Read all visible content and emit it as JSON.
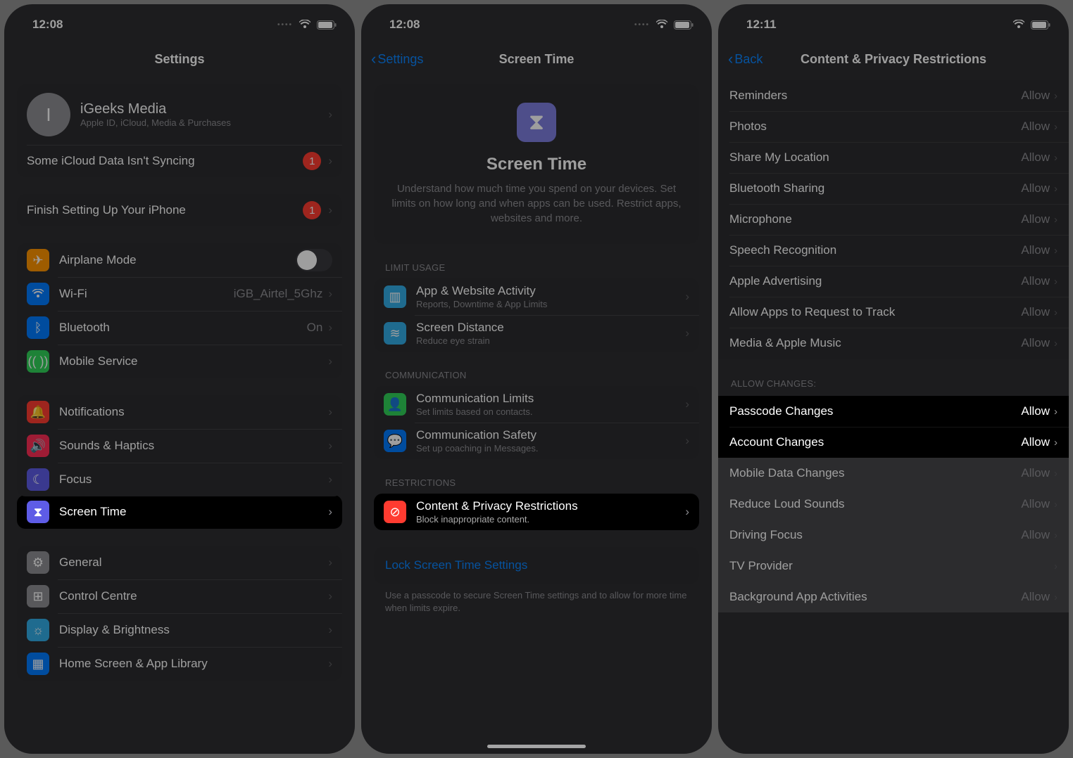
{
  "status": {
    "time1": "12:08",
    "time2": "12:08",
    "time3": "12:11"
  },
  "p1": {
    "nav_title": "Settings",
    "profile_name": "iGeeks Media",
    "profile_sub": "Apple ID, iCloud, Media & Purchases",
    "icloud_warning": "Some iCloud Data Isn't Syncing",
    "icloud_badge": "1",
    "finish_setup": "Finish Setting Up Your iPhone",
    "finish_badge": "1",
    "airplane": "Airplane Mode",
    "wifi": "Wi-Fi",
    "wifi_val": "iGB_Airtel_5Ghz",
    "bt": "Bluetooth",
    "bt_val": "On",
    "mobile": "Mobile Service",
    "notifications": "Notifications",
    "sounds": "Sounds & Haptics",
    "focus": "Focus",
    "screentime": "Screen Time",
    "general": "General",
    "control_centre": "Control Centre",
    "display": "Display & Brightness",
    "home": "Home Screen & App Library"
  },
  "p2": {
    "back": "Settings",
    "title": "Screen Time",
    "hero_title": "Screen Time",
    "hero_body": "Understand how much time you spend on your devices. Set limits on how long and when apps can be used. Restrict apps, websites and more.",
    "hdr_limit": "LIMIT USAGE",
    "app_activity": "App & Website Activity",
    "app_activity_sub": "Reports, Downtime & App Limits",
    "screen_distance": "Screen Distance",
    "screen_distance_sub": "Reduce eye strain",
    "hdr_comm": "COMMUNICATION",
    "comm_limits": "Communication Limits",
    "comm_limits_sub": "Set limits based on contacts.",
    "comm_safety": "Communication Safety",
    "comm_safety_sub": "Set up coaching in Messages.",
    "hdr_restrict": "RESTRICTIONS",
    "content_priv": "Content & Privacy Restrictions",
    "content_priv_sub": "Block inappropriate content.",
    "lock_link": "Lock Screen Time Settings",
    "lock_footer": "Use a passcode to secure Screen Time settings and to allow for more time when limits expire."
  },
  "p3": {
    "back": "Back",
    "title": "Content & Privacy Restrictions",
    "allow": "Allow",
    "items_top": [
      "Reminders",
      "Photos",
      "Share My Location",
      "Bluetooth Sharing",
      "Microphone",
      "Speech Recognition",
      "Apple Advertising",
      "Allow Apps to Request to Track",
      "Media & Apple Music"
    ],
    "hdr_changes": "ALLOW CHANGES:",
    "items_changes": [
      {
        "label": "Passcode Changes",
        "hi": true
      },
      {
        "label": "Account Changes",
        "hi": true
      },
      {
        "label": "Mobile Data Changes",
        "hi": false
      },
      {
        "label": "Reduce Loud Sounds",
        "hi": false
      },
      {
        "label": "Driving Focus",
        "hi": false
      },
      {
        "label": "TV Provider",
        "hi": false
      },
      {
        "label": "Background App Activities",
        "hi": false
      }
    ]
  }
}
